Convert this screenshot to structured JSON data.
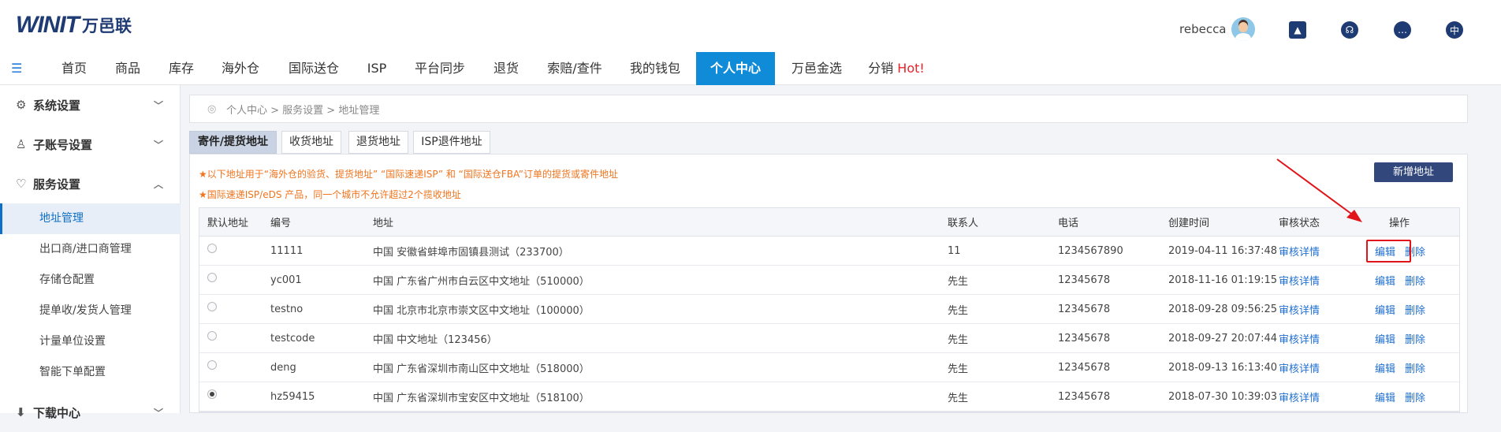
{
  "header": {
    "logo_mark": "WINIT",
    "logo_cn": "万邑联",
    "username": "rebecca",
    "icons": [
      "upload-folder-icon",
      "headset-icon",
      "chat-icon",
      "language-icon"
    ],
    "language_label": "中"
  },
  "nav": {
    "items": [
      {
        "label": "首页"
      },
      {
        "label": "商品"
      },
      {
        "label": "库存"
      },
      {
        "label": "海外仓"
      },
      {
        "label": "国际送仓"
      },
      {
        "label": "ISP"
      },
      {
        "label": "平台同步"
      },
      {
        "label": "退货"
      },
      {
        "label": "索赔/查件"
      },
      {
        "label": "我的钱包"
      },
      {
        "label": "个人中心"
      },
      {
        "label": "万邑金选"
      },
      {
        "label": "分销",
        "hot": "Hot!"
      }
    ],
    "active_index": 10
  },
  "sidebar": {
    "groups": [
      {
        "label": "系统设置"
      },
      {
        "label": "子账号设置"
      },
      {
        "label": "服务设置"
      },
      {
        "label": "下载中心"
      }
    ],
    "items": [
      {
        "label": "地址管理"
      },
      {
        "label": "出口商/进口商管理"
      },
      {
        "label": "存储仓配置"
      },
      {
        "label": "提单收/发货人管理"
      },
      {
        "label": "计量单位设置"
      },
      {
        "label": "智能下单配置"
      }
    ]
  },
  "breadcrumb": "个人中心 > 服务设置 > 地址管理",
  "tabs": [
    {
      "label": "寄件/提货地址"
    },
    {
      "label": "收货地址"
    },
    {
      "label": "退货地址"
    },
    {
      "label": "ISP退件地址"
    }
  ],
  "notices": [
    "★以下地址用于“海外仓的验货、提货地址” “国际速递ISP” 和 “国际送仓FBA”订单的提货或寄件地址",
    "★国际速递ISP/eDS 产品，同一个城市不允许超过2个揽收地址"
  ],
  "add_button": "新增地址",
  "table": {
    "headers": [
      "默认地址",
      "编号",
      "地址",
      "联系人",
      "电话",
      "创建时间",
      "审核状态",
      "操作"
    ],
    "rows": [
      {
        "default": false,
        "code": "11111",
        "address": "中国 安徽省蚌埠市固镇县测试（233700）",
        "contact": "11",
        "phone": "1234567890",
        "created": "2019-04-11 16:37:48",
        "status": "审核详情",
        "edit": "编辑",
        "delete": "删除"
      },
      {
        "default": false,
        "code": "yc001",
        "address": "中国 广东省广州市白云区中文地址（510000）",
        "contact": "先生",
        "phone": "12345678",
        "created": "2018-11-16 01:19:15",
        "status": "审核详情",
        "edit": "编辑",
        "delete": "删除"
      },
      {
        "default": false,
        "code": "testno",
        "address": "中国 北京市北京市崇文区中文地址（100000）",
        "contact": "先生",
        "phone": "12345678",
        "created": "2018-09-28 09:56:25",
        "status": "审核详情",
        "edit": "编辑",
        "delete": "删除"
      },
      {
        "default": false,
        "code": "testcode",
        "address": "中国 中文地址（123456）",
        "contact": "先生",
        "phone": "12345678",
        "created": "2018-09-27 20:07:44",
        "status": "审核详情",
        "edit": "编辑",
        "delete": "删除"
      },
      {
        "default": false,
        "code": "deng",
        "address": "中国 广东省深圳市南山区中文地址（518000）",
        "contact": "先生",
        "phone": "12345678",
        "created": "2018-09-13 16:13:40",
        "status": "审核详情",
        "edit": "编辑",
        "delete": "删除"
      },
      {
        "default": true,
        "code": "hz59415",
        "address": "中国 广东省深圳市宝安区中文地址（518100）",
        "contact": "先生",
        "phone": "12345678",
        "created": "2018-07-30 10:39:03",
        "status": "审核详情",
        "edit": "编辑",
        "delete": "删除"
      }
    ]
  },
  "colors": {
    "brand": "#1f3b73",
    "nav_active": "#0f8bd8",
    "notice": "#f0741e",
    "link": "#1f6fd0",
    "highlight": "#e0141a"
  }
}
